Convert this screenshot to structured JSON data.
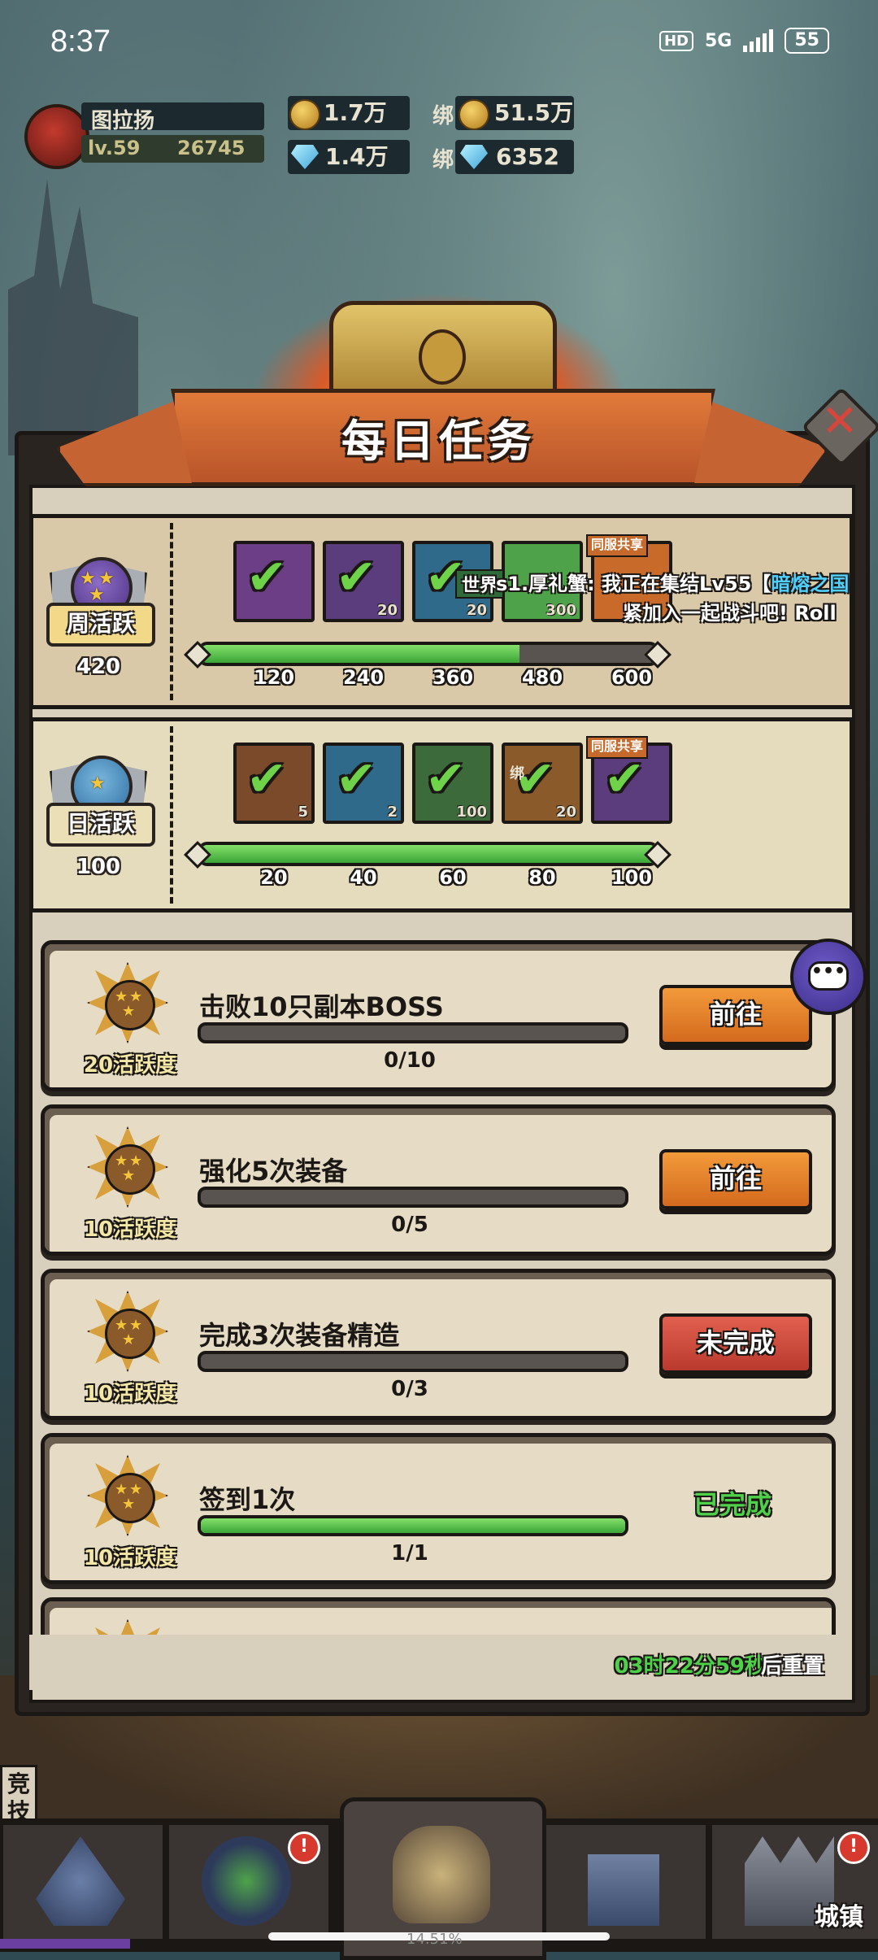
{
  "status_bar": {
    "time": "8:37",
    "hd": "HD",
    "network": "5G",
    "battery": "55"
  },
  "player": {
    "name": "图拉扬",
    "level": "lv.59",
    "power": "26745"
  },
  "resources": {
    "gold": "1.7万",
    "bound_label": "绑",
    "bound_gold": "51.5万",
    "diamond": "1.4万",
    "bound_diamond": "6352"
  },
  "panel": {
    "title": "每日任务"
  },
  "weekly": {
    "label": "周活跃",
    "score": "420",
    "progress": 0.7,
    "tiers": [
      "120",
      "240",
      "360",
      "480",
      "600"
    ],
    "reward_counts": [
      "",
      "20",
      "20",
      "300",
      ""
    ],
    "share_tag": "同服共享"
  },
  "daily": {
    "label": "日活跃",
    "score": "100",
    "progress": 1.0,
    "tiers": [
      "20",
      "40",
      "60",
      "80",
      "100"
    ],
    "reward_counts": [
      "5",
      "2",
      "100",
      "20",
      ""
    ],
    "bound_tag": "绑",
    "share_tag": "同服共享"
  },
  "chat": {
    "channel": "世界",
    "line1_prefix": "s1.厚礼蟹: 我正在集结Lv55【",
    "line1_highlight": "暗熔之国",
    "line2": "紧加入一起战斗吧! ",
    "line2_tail": "Roll"
  },
  "tasks": [
    {
      "points": "20活跃度",
      "title": "击败10只副本BOSS",
      "progress_text": "0/10",
      "progress": 0.0,
      "action": "前往",
      "state": "go"
    },
    {
      "points": "10活跃度",
      "title": "强化5次装备",
      "progress_text": "0/5",
      "progress": 0.0,
      "action": "前往",
      "state": "go"
    },
    {
      "points": "10活跃度",
      "title": "完成3次装备精造",
      "progress_text": "0/3",
      "progress": 0.0,
      "action": "未完成",
      "state": "incomplete"
    },
    {
      "points": "10活跃度",
      "title": "签到1次",
      "progress_text": "1/1",
      "progress": 1.0,
      "action": "已完成",
      "state": "done"
    }
  ],
  "reset": {
    "time": "03时22分59秒",
    "suffix": "后重置"
  },
  "side_label": "竞技",
  "bottom_nav": {
    "town_label": "城镇",
    "badge": "!",
    "percent": "14.51%"
  },
  "colors": {
    "accent_green": "#4fd04a",
    "button_orange": "#e07a2a",
    "button_red": "#c9473a",
    "panel_bg": "#d9cfbd"
  }
}
